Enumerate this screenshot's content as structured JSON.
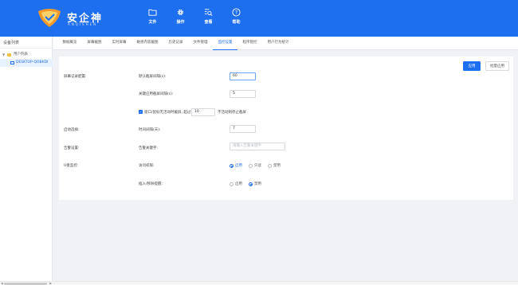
{
  "header": {
    "logo_title": "安企神",
    "logo_sub": "ANQISHEN",
    "nav": [
      {
        "label": "文件",
        "icon": "folder-icon"
      },
      {
        "label": "操作",
        "icon": "gear-icon"
      },
      {
        "label": "查看",
        "icon": "search-list-icon"
      },
      {
        "label": "帮助",
        "icon": "help-icon"
      }
    ]
  },
  "sidebar": {
    "title": "设备列表",
    "root_label": "用户列表",
    "device_label": "DESKTOP-QOBKDI"
  },
  "tabs": [
    "数据概览",
    "屏幕截图",
    "实时屏幕",
    "敏感内容截图",
    "历史记录",
    "文件管理",
    "监控设置",
    "程序管控",
    "用户行为统计"
  ],
  "active_tab": 6,
  "actions": {
    "apply": "应用",
    "batch_apply": "批量应用"
  },
  "form": {
    "screen_section": "屏幕记录配置:",
    "default_interval_label": "默认截屏间隔(s):",
    "default_interval_value": "60",
    "keyword_interval_label": "关键应用截屏间隔(s):",
    "keyword_interval_value": "5",
    "inactive_check_label": "窗口/鼠标无活动时截屏, 超过",
    "inactive_value": "10",
    "inactive_suffix": "不活动则停止截屏",
    "process_section": "启动选择:",
    "time_interval_label": "时间间隔(天):",
    "time_interval_value": "7",
    "alert_section": "告警设置:",
    "alert_keyword_label": "告警关键字:",
    "alert_keyword_placeholder": "请输入告警关键字",
    "usb_section": "U盘监控:",
    "access_label": "访问权限:",
    "access_options": [
      "启用",
      "只读",
      "禁用"
    ],
    "access_selected": 0,
    "insert_label": "插入/移除提醒:",
    "insert_options": [
      "启用",
      "禁用"
    ],
    "insert_selected": 1
  },
  "colors": {
    "brand": "#1e6ef0",
    "header_bg": "#1e6ef0"
  }
}
